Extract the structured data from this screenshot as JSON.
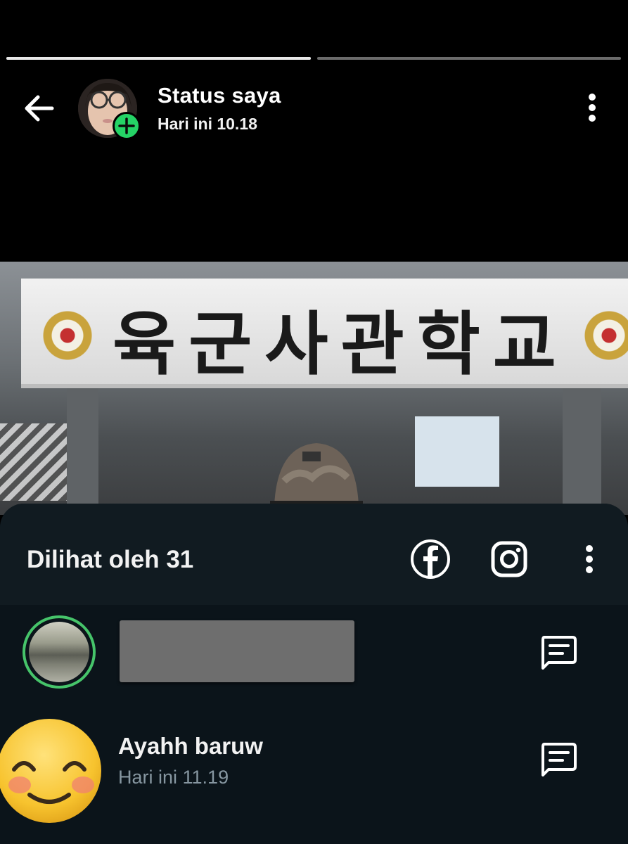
{
  "header": {
    "title": "Status saya",
    "timestamp": "Hari ini 10.18",
    "progress": [
      1.0,
      0.0
    ]
  },
  "photo": {
    "sign_text": "육군사관학교"
  },
  "viewers": {
    "label": "Dilihat oleh 31",
    "share_icons": [
      "facebook-icon",
      "instagram-icon"
    ],
    "list": [
      {
        "name": "",
        "time": "",
        "redacted": true
      },
      {
        "name": "Ayahh baruw",
        "time": "Hari ini 11.19"
      }
    ]
  },
  "colors": {
    "accent_green": "#25d366",
    "sheet_bg": "#0b141a",
    "sheet_header_bg": "#111b21",
    "secondary_text": "#8696a0"
  }
}
